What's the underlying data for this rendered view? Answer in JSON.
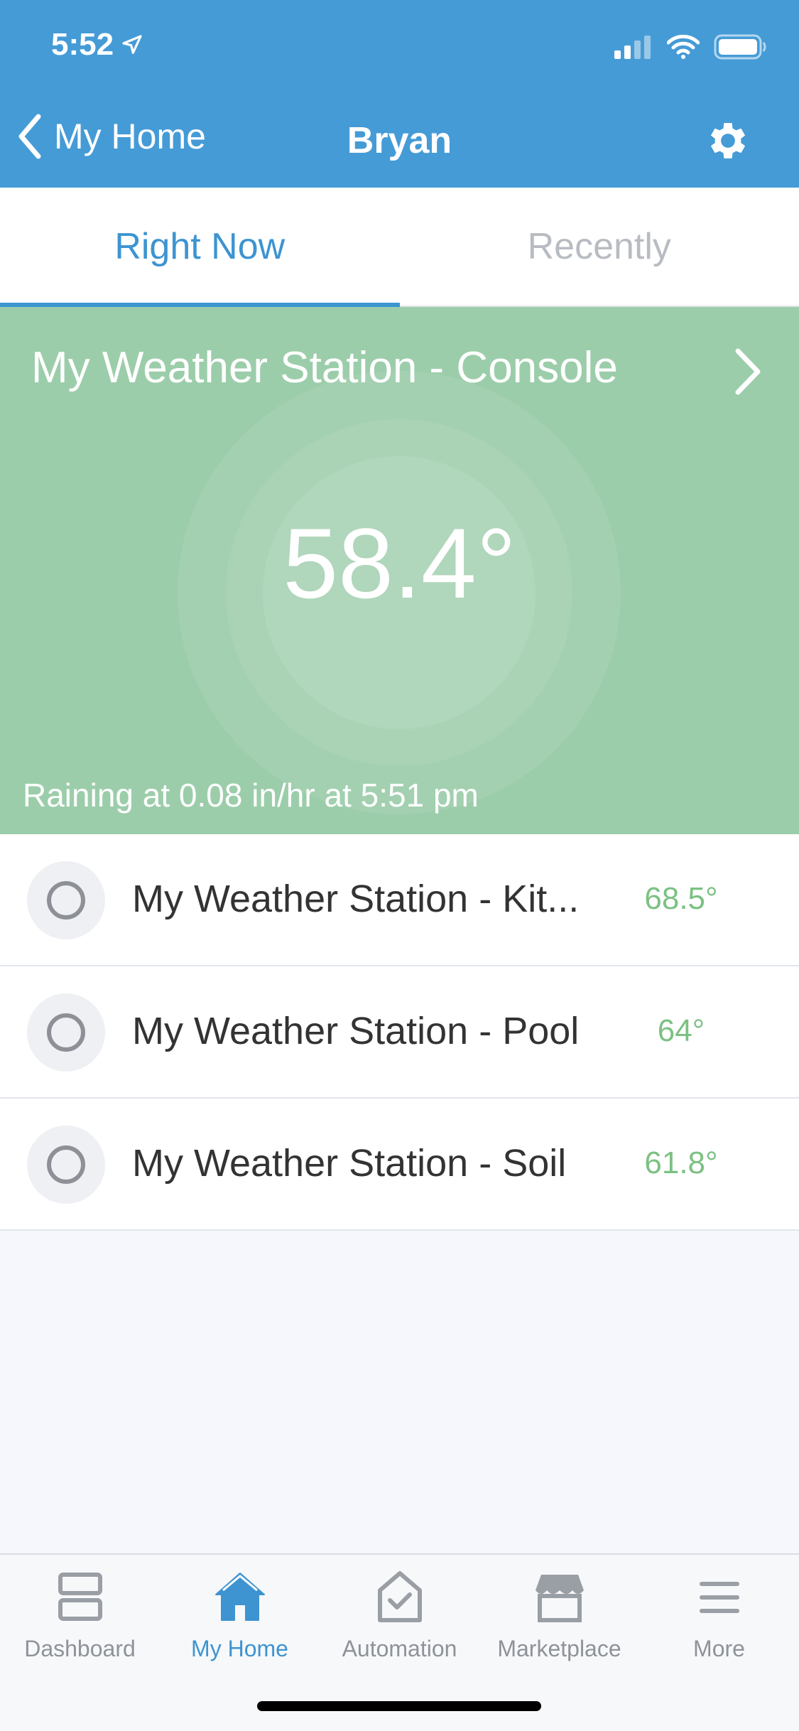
{
  "status_bar": {
    "time": "5:52"
  },
  "nav": {
    "back_label": "My Home",
    "title": "Bryan"
  },
  "tabs": [
    {
      "label": "Right Now",
      "active": true
    },
    {
      "label": "Recently",
      "active": false
    }
  ],
  "console": {
    "title": "My Weather Station - Console",
    "temperature": "58.4°",
    "status": "Raining at 0.08 in/hr at 5:51 pm",
    "background_color": "#9ccdaa"
  },
  "devices": [
    {
      "name": "My Weather Station - Kit...",
      "temperature": "68.5°"
    },
    {
      "name": "My Weather Station - Pool",
      "temperature": "64°"
    },
    {
      "name": "My Weather Station - Soil",
      "temperature": "61.8°"
    }
  ],
  "bottom_nav": [
    {
      "label": "Dashboard",
      "icon": "dashboard-icon",
      "active": false
    },
    {
      "label": "My Home",
      "icon": "home-icon",
      "active": true
    },
    {
      "label": "Automation",
      "icon": "automation-icon",
      "active": false
    },
    {
      "label": "Marketplace",
      "icon": "marketplace-icon",
      "active": false
    },
    {
      "label": "More",
      "icon": "menu-icon",
      "active": false
    }
  ],
  "colors": {
    "accent": "#459bd6",
    "active_tab": "#3d94d1",
    "temp_green": "#7cc183"
  }
}
